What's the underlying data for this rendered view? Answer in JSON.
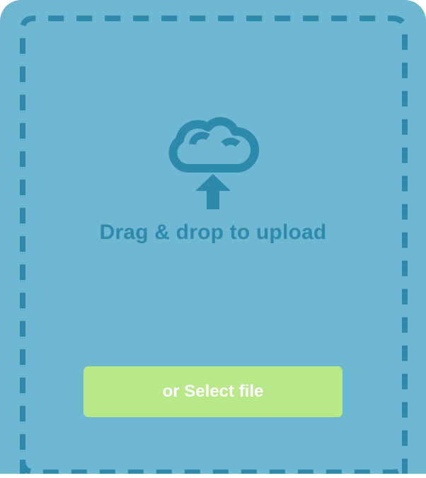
{
  "upload": {
    "title": "Drag & drop to upload",
    "select_button_label": "or Select file",
    "icon": "cloud-upload-icon"
  },
  "colors": {
    "background": "#6fb8d1",
    "accent": "#2e8aab",
    "button": "#b8e888",
    "button_text": "#ffffff"
  }
}
